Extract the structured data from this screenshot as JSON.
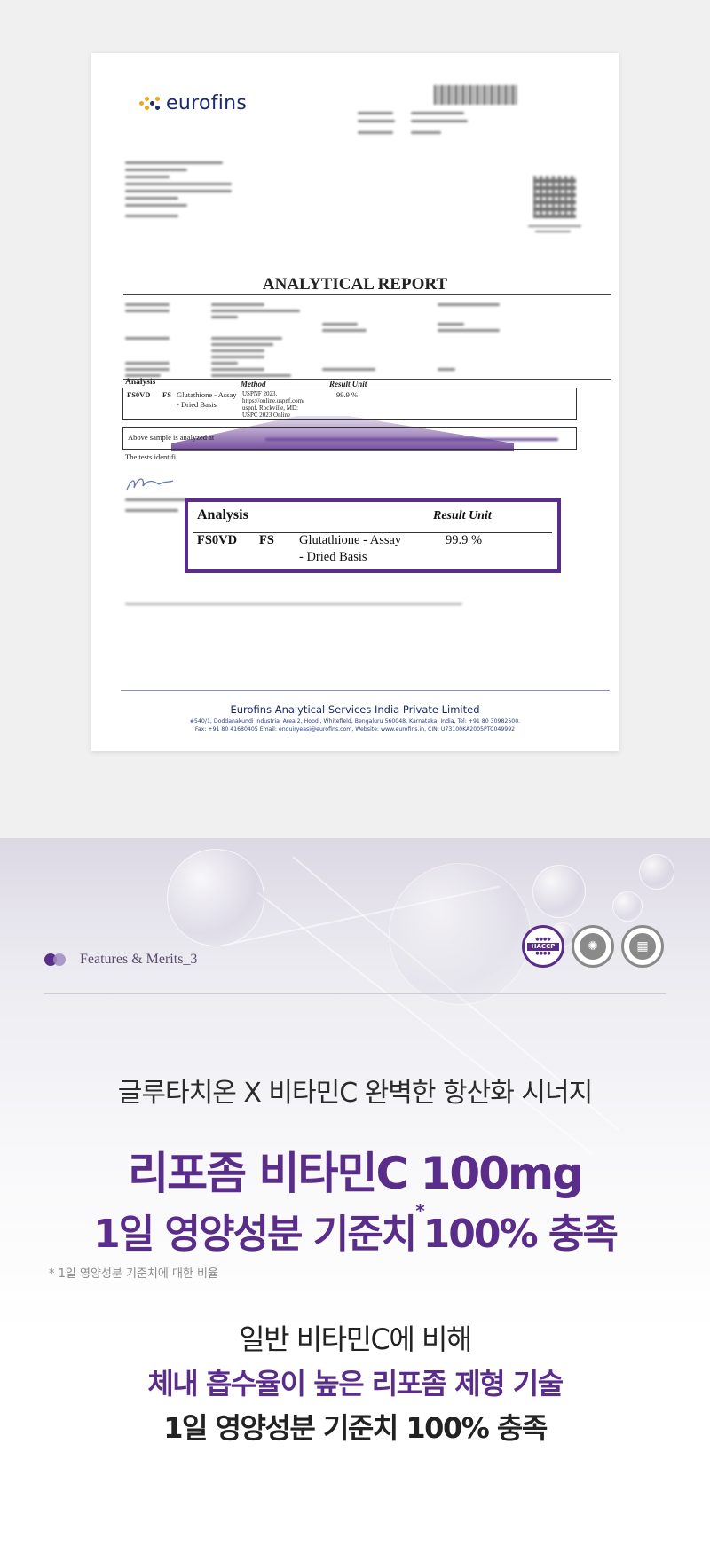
{
  "report": {
    "logo_text": "eurofins",
    "title": "ANALYTICAL REPORT",
    "analysis_header": "Analysis",
    "method_header": "Method",
    "result_header": "Result Unit",
    "row_code": "FS0VD",
    "row_fs": "FS",
    "row_desc_1": "Glutathione - Assay",
    "row_desc_2": "- Dried Basis",
    "row_method_1": "USPNF 2023.",
    "row_method_2": "https://online.uspnf.com/",
    "row_method_3": "uspnf. Rockville, MD:",
    "row_method_4": "USPC 2023 Online",
    "row_result": "99.9 %",
    "note_line": "Above sample is analyzed at",
    "tests_line": "The tests identifi",
    "zoom": {
      "analysis": "Analysis",
      "result_unit": "Result  Unit",
      "code": "FS0VD",
      "fs": "FS",
      "desc_1": "Glutathione - Assay",
      "desc_2": "- Dried Basis",
      "result": "99.9  %"
    },
    "footer_name": "Eurofins Analytical Services India Private Limited",
    "footer_addr_1": "#540/1, Doddanakundi Industrial Area 2, Hoodi, Whitefield, Bengaluru 560048, Karnataka, India, Tel: +91 80 30982500.",
    "footer_addr_2": "Fax: +91 80 41680405 Email: enquiryeasi@eurofins.com, Website: www.eurofins.in, CIN: U73100KA2005PTC049992"
  },
  "features": {
    "label": "Features & Merits_3",
    "badge_haccp": "HACCP"
  },
  "headline": {
    "line1": "글루타치온 X 비타민C 완벽한 항산화 시너지",
    "line2": "리포좀 비타민C 100mg",
    "line3_a": "1일 영양성분 기준치",
    "line3_star": "*",
    "line3_b": "100% 충족",
    "footnote": "* 1일 영양성분 기준치에 대한 비율",
    "line5": "일반 비타민C에 비해",
    "line6": "체내 흡수율이 높은 리포좀 제형 기술",
    "line7": "1일 영양성분 기준치 100% 충족"
  },
  "colors": {
    "brand_purple": "#5b2d8a",
    "eurofins_navy": "#1a2a6c",
    "eurofins_orange": "#f4a11d"
  }
}
